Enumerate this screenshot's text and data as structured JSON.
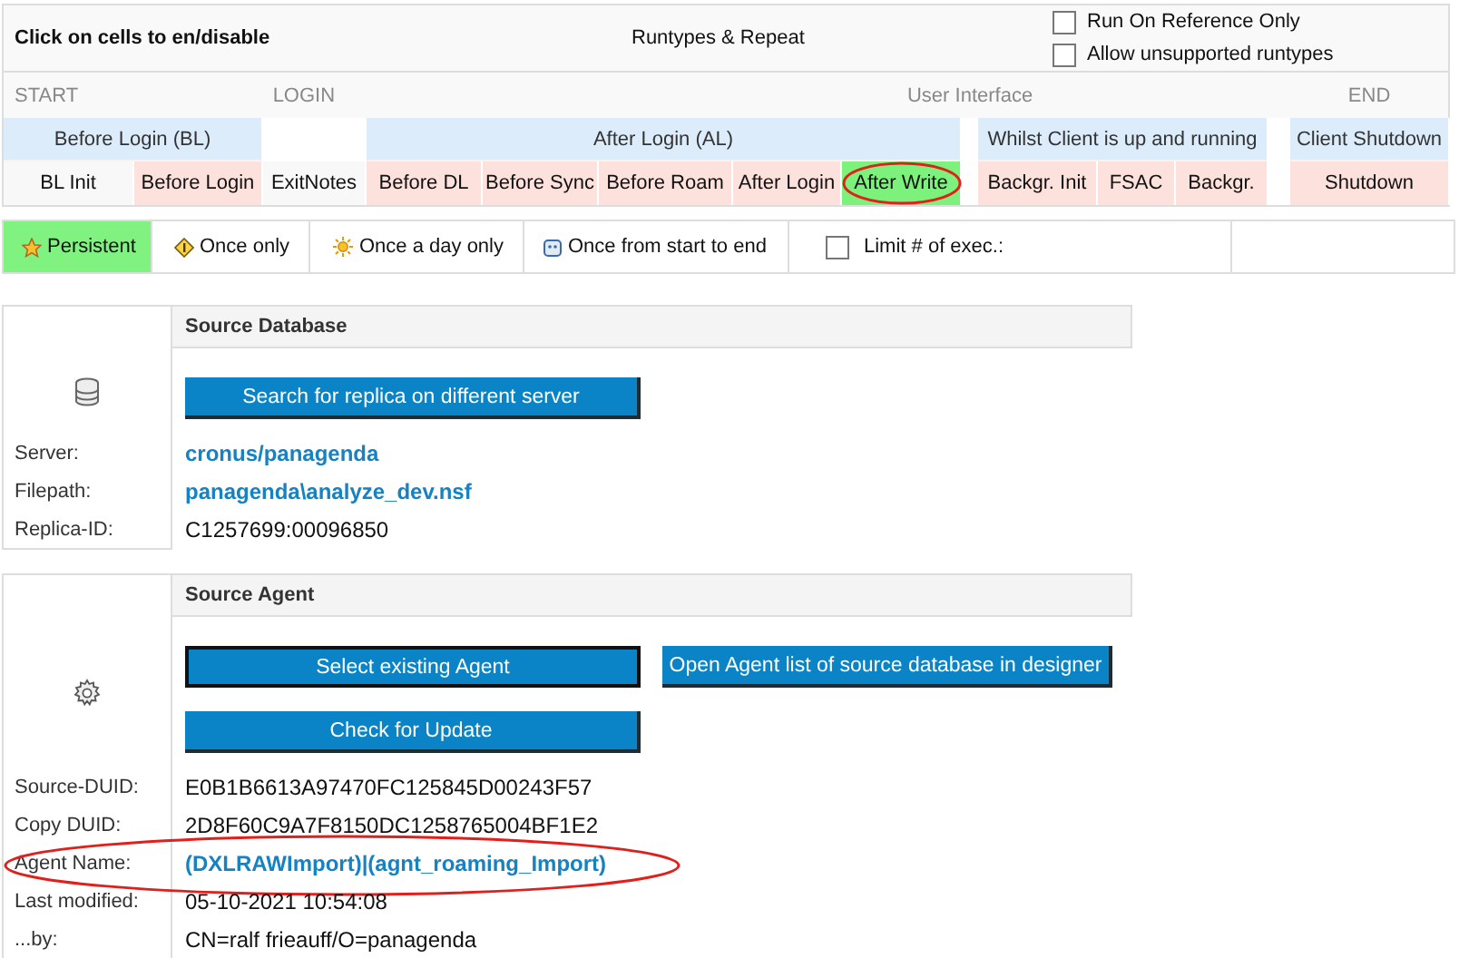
{
  "header": {
    "instruction": "Click on cells to en/disable",
    "title": "Runtypes & Repeat",
    "options": [
      {
        "label": "Run On Reference Only",
        "checked": false
      },
      {
        "label": "Allow unsupported runtypes",
        "checked": false
      }
    ]
  },
  "phases": [
    "START",
    "LOGIN",
    "User Interface",
    "END"
  ],
  "groups": [
    "Before Login (BL)",
    "After Login (AL)",
    "Whilst Client is up and running",
    "Client Shutdown"
  ],
  "cells": [
    {
      "label": "BL Init",
      "enabled": false,
      "selected": false,
      "circled": false
    },
    {
      "label": "Before Login",
      "enabled": true,
      "selected": false,
      "circled": false
    },
    {
      "label": "ExitNotes",
      "enabled": false,
      "selected": false,
      "circled": false
    },
    {
      "label": "Before DL",
      "enabled": true,
      "selected": false,
      "circled": false
    },
    {
      "label": "Before Sync",
      "enabled": true,
      "selected": false,
      "circled": false
    },
    {
      "label": "Before Roam",
      "enabled": true,
      "selected": false,
      "circled": false
    },
    {
      "label": "After Login",
      "enabled": true,
      "selected": false,
      "circled": false
    },
    {
      "label": "After Write",
      "enabled": true,
      "selected": true,
      "circled": true
    },
    {
      "label": "Backgr. Init",
      "enabled": true,
      "selected": false,
      "circled": false
    },
    {
      "label": "FSAC",
      "enabled": true,
      "selected": false,
      "circled": false
    },
    {
      "label": "Backgr.",
      "enabled": true,
      "selected": false,
      "circled": false
    },
    {
      "label": "Shutdown",
      "enabled": true,
      "selected": false,
      "circled": false
    }
  ],
  "repeat": [
    {
      "kind": "star",
      "label": "Persistent",
      "selected": true
    },
    {
      "kind": "once",
      "label": "Once only",
      "selected": false
    },
    {
      "kind": "sun",
      "label": "Once a day only",
      "selected": false
    },
    {
      "kind": "face",
      "label": "Once from start to end",
      "selected": false
    },
    {
      "kind": "checkbox",
      "label": "Limit # of exec.:",
      "checked": false
    }
  ],
  "sections": [
    {
      "title": "Source Database",
      "buttons": [
        [
          {
            "label": "Search for replica on different server",
            "focused": false
          }
        ]
      ],
      "fields": [
        {
          "label": "Server:",
          "value": "cronus/panagenda",
          "kind": "link",
          "circled": false
        },
        {
          "label": "Filepath:",
          "value": "panagenda\\analyze_dev.nsf",
          "kind": "link",
          "circled": false
        },
        {
          "label": "Replica-ID:",
          "value": "C1257699:00096850",
          "kind": "text",
          "circled": false
        }
      ]
    },
    {
      "title": "Source Agent",
      "buttons": [
        [
          {
            "label": "Select existing Agent",
            "focused": true
          },
          {
            "label": "Open Agent list of source database in designer",
            "focused": false
          }
        ],
        [
          {
            "label": "Check for Update",
            "focused": false
          }
        ]
      ],
      "fields": [
        {
          "label": "Source-DUID:",
          "value": "E0B1B6613A97470FC125845D00243F57",
          "kind": "text",
          "circled": false
        },
        {
          "label": "Copy DUID:",
          "value": "2D8F60C9A7F8150DC1258765004BF1E2",
          "kind": "text",
          "circled": false
        },
        {
          "label": "Agent Name:",
          "value": "(DXLRAWImport)|(agnt_roaming_Import)",
          "kind": "link",
          "circled": true
        },
        {
          "label": "Last modified:",
          "value": "05-10-2021 10:54:08",
          "kind": "text",
          "circled": false
        },
        {
          "label": "...by:",
          "value": "CN=ralf frieauff/O=panagenda",
          "kind": "text",
          "circled": false
        }
      ]
    }
  ]
}
